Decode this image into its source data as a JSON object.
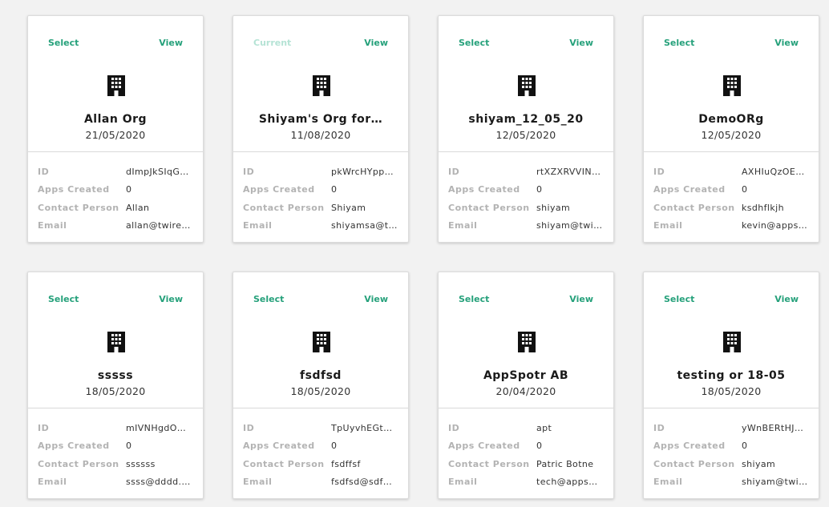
{
  "labels": {
    "id": "ID",
    "apps_created": "Apps Created",
    "contact_person": "Contact Person",
    "email": "Email"
  },
  "colors": {
    "accent": "#26a17b",
    "accent_disabled": "#b5e3d5",
    "label": "#b3b3b3",
    "icon": "#111111"
  },
  "icons": {
    "org": "building-icon"
  },
  "cards": [
    {
      "select_label": "Select",
      "is_current": false,
      "view_label": "View",
      "name": "Allan Org",
      "date": "21/05/2020",
      "id": "dImpJkSIqG…",
      "apps_created": "0",
      "contact_person": "Allan",
      "email": "allan@twire…"
    },
    {
      "select_label": "Current",
      "is_current": true,
      "view_label": "View",
      "name": "Shiyam's Org for…",
      "date": "11/08/2020",
      "id": "pkWrcHYpp…",
      "apps_created": "0",
      "contact_person": "Shiyam",
      "email": "shiyamsa@t…"
    },
    {
      "select_label": "Select",
      "is_current": false,
      "view_label": "View",
      "name": "shiyam_12_05_20",
      "date": "12/05/2020",
      "id": "rtXZXRVVIN…",
      "apps_created": "0",
      "contact_person": "shiyam",
      "email": "shiyam@twi…"
    },
    {
      "select_label": "Select",
      "is_current": false,
      "view_label": "View",
      "name": "DemoORg",
      "date": "12/05/2020",
      "id": "AXHIuQzOE…",
      "apps_created": "0",
      "contact_person": "ksdhflkjh",
      "email": "kevin@apps…"
    },
    {
      "select_label": "Select",
      "is_current": false,
      "view_label": "View",
      "name": "sssss",
      "date": "18/05/2020",
      "id": "mIVNHgdO…",
      "apps_created": "0",
      "contact_person": "ssssss",
      "email": "ssss@dddd.…"
    },
    {
      "select_label": "Select",
      "is_current": false,
      "view_label": "View",
      "name": "fsdfsd",
      "date": "18/05/2020",
      "id": "TpUyvhEGt…",
      "apps_created": "0",
      "contact_person": "fsdffsf",
      "email": "fsdfsd@sdf…"
    },
    {
      "select_label": "Select",
      "is_current": false,
      "view_label": "View",
      "name": "AppSpotr AB",
      "date": "20/04/2020",
      "id": "apt",
      "apps_created": "0",
      "contact_person": "Patric Botne",
      "email": "tech@apps…"
    },
    {
      "select_label": "Select",
      "is_current": false,
      "view_label": "View",
      "name": "testing or 18-05",
      "date": "18/05/2020",
      "id": "yWnBERtHJ…",
      "apps_created": "0",
      "contact_person": "shiyam",
      "email": "shiyam@twi…"
    }
  ]
}
